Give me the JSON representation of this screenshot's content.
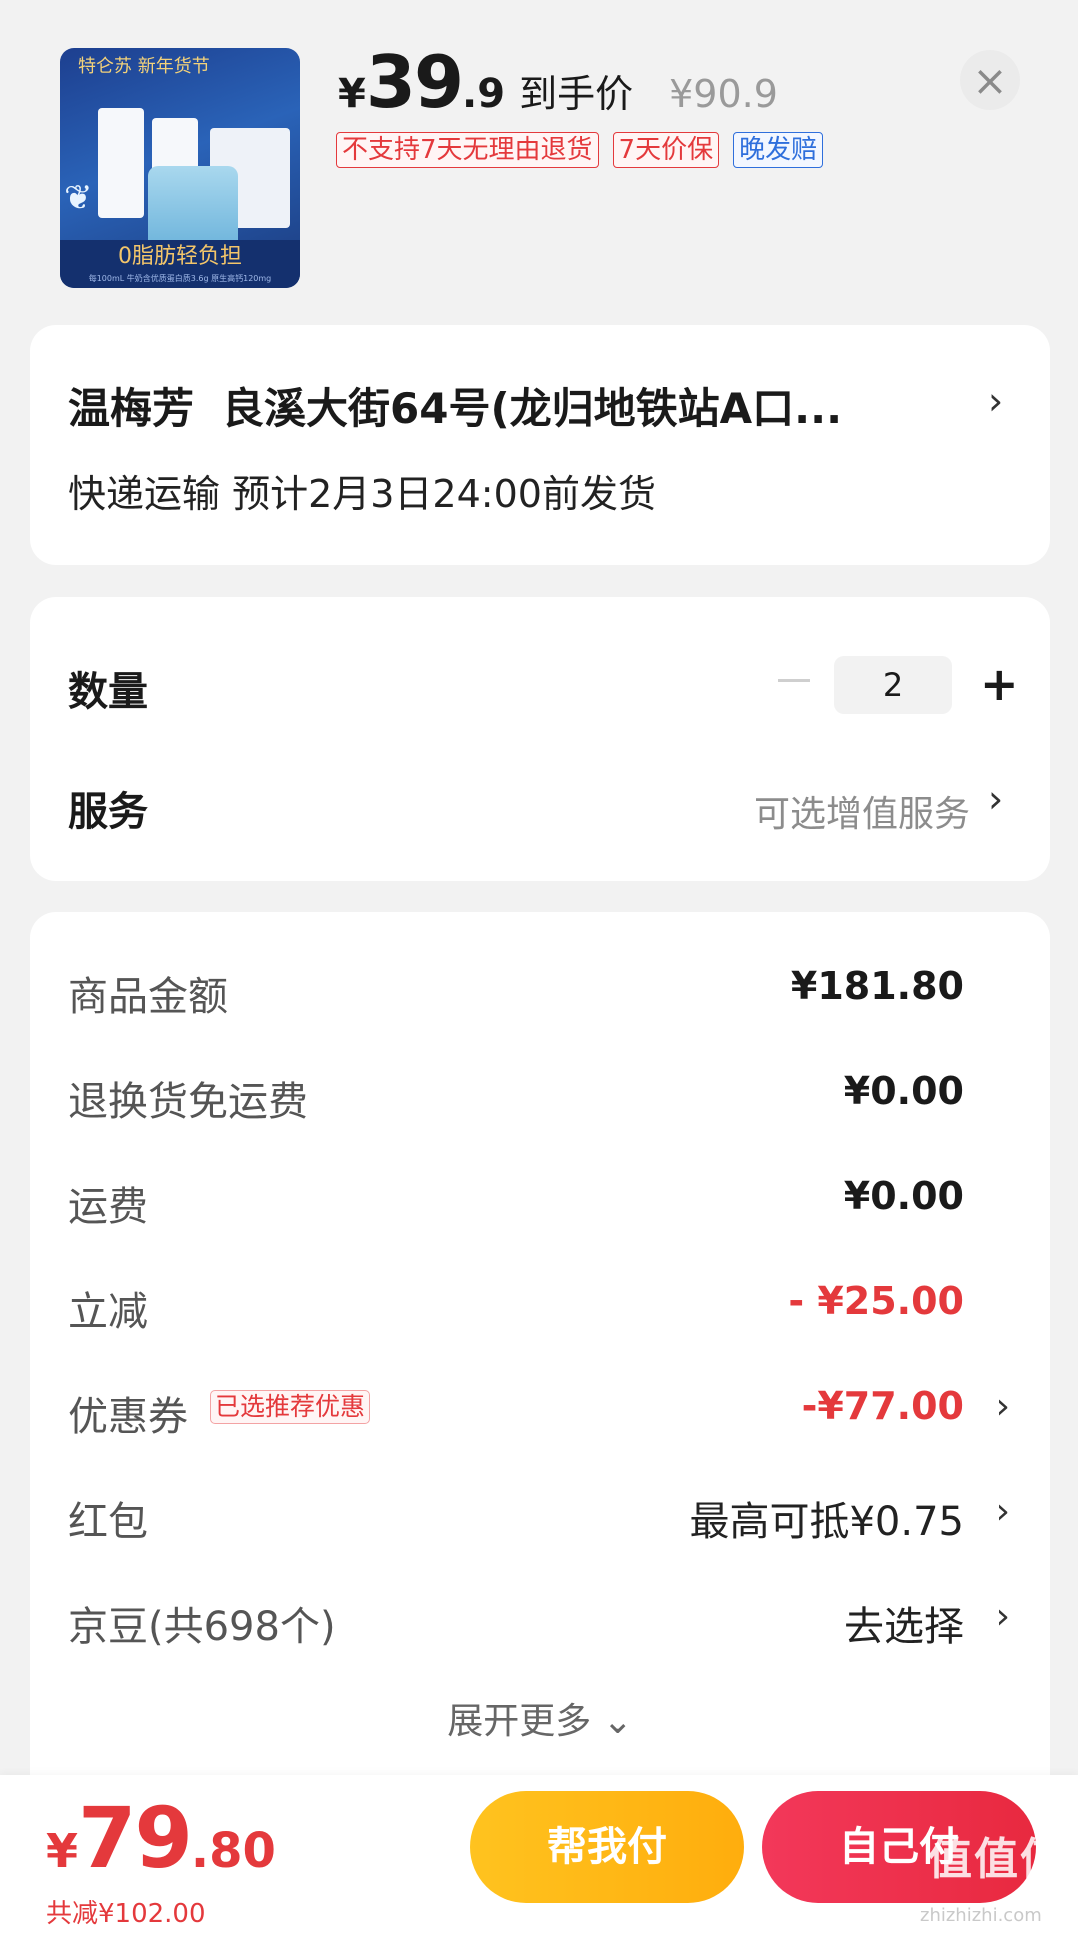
{
  "product": {
    "banner_text": "特仑苏 新年货节",
    "image_slogan": "0脂肪轻负担",
    "image_subtext": "每100mL 牛奶含优质蛋白质3.6g 原生高钙120mg",
    "price_yen": "¥",
    "price_int": "39",
    "price_dec": ".9",
    "price_label": "到手价",
    "original_price": "¥90.9",
    "tags": [
      "不支持7天无理由退货",
      "7天价保",
      "晚发赔"
    ]
  },
  "address": {
    "name": "温梅芳",
    "address": "良溪大街64号(龙归地铁站A口...",
    "shipping": "快递运输 预计2月3日24:00前发货"
  },
  "quantity": {
    "label": "数量",
    "value": "2"
  },
  "service": {
    "label": "服务",
    "value": "可选增值服务"
  },
  "fees": {
    "goods_label": "商品金额",
    "goods_value": "¥181.80",
    "return_label": "退换货免运费",
    "return_value": "¥0.00",
    "freight_label": "运费",
    "freight_value": "¥0.00",
    "discount_label": "立减",
    "discount_value": "- ¥25.00",
    "coupon_label": "优惠券",
    "coupon_badge": "已选推荐优惠",
    "coupon_value": "-¥77.00",
    "redpacket_label": "红包",
    "redpacket_value": "最高可抵¥0.75",
    "jingdou_label": "京豆(共698个)",
    "jingdou_value": "去选择",
    "expand_more": "展开更多 ⌄"
  },
  "footer": {
    "total_yen": "¥",
    "total_int": "79",
    "total_dec": ".80",
    "saved": "共减¥102.00",
    "help_pay": "帮我付",
    "self_pay": "自己付",
    "watermark": "值值值",
    "watermark_sub": "zhizhizhi.com"
  },
  "colors": {
    "accent_red": "#e4393c",
    "help_button": "#ffb714",
    "self_button": "#ee3048",
    "tag_blue": "#2f6fdc"
  },
  "icons": [
    "close-icon",
    "chevron-right-icon",
    "minus-icon",
    "plus-icon",
    "chevron-down-icon"
  ]
}
